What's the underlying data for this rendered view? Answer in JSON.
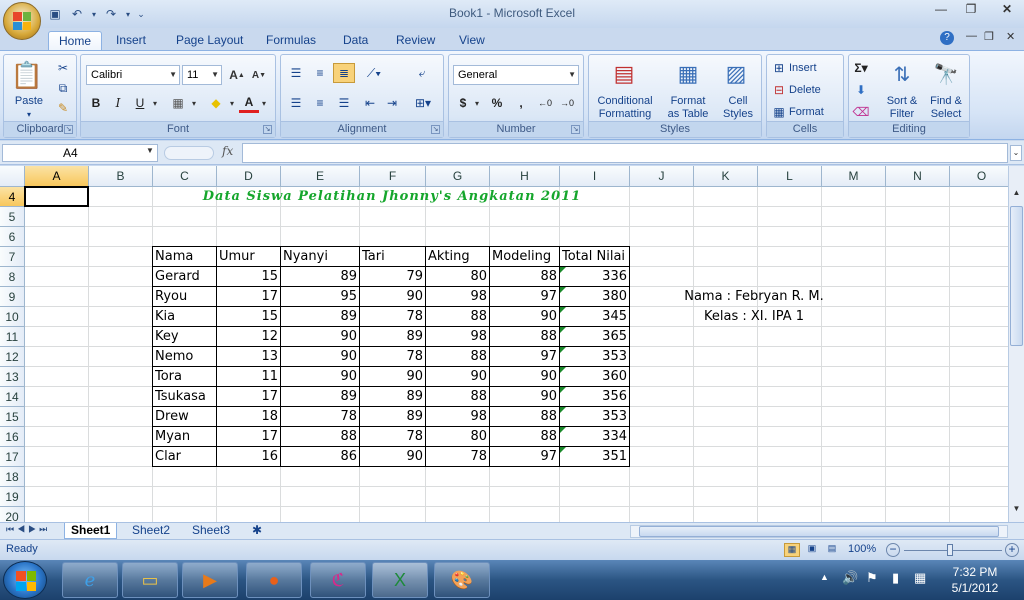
{
  "window": {
    "title": "Book1 - Microsoft Excel"
  },
  "ribbon_tabs": [
    "Home",
    "Insert",
    "Page Layout",
    "Formulas",
    "Data",
    "Review",
    "View"
  ],
  "ribbon": {
    "clipboard": {
      "label": "Clipboard",
      "paste": "Paste"
    },
    "font": {
      "label": "Font",
      "name": "Calibri",
      "size": "11",
      "bold": "B",
      "italic": "I",
      "underline": "U"
    },
    "alignment": {
      "label": "Alignment"
    },
    "number": {
      "label": "Number",
      "format": "General",
      "currency": "$",
      "percent": "%",
      "comma": ","
    },
    "styles": {
      "label": "Styles",
      "conditional": "Conditional\nFormatting",
      "format_table": "Format\nas Table",
      "cell_styles": "Cell\nStyles"
    },
    "cells": {
      "label": "Cells",
      "insert": "Insert",
      "delete": "Delete",
      "format": "Format"
    },
    "editing": {
      "label": "Editing",
      "sort": "Sort &\nFilter",
      "find": "Find &\nSelect"
    }
  },
  "formula_bar": {
    "name_box": "A4",
    "fx": "fx",
    "value": ""
  },
  "columns": [
    "A",
    "B",
    "C",
    "D",
    "E",
    "F",
    "G",
    "H",
    "I",
    "J",
    "K",
    "L",
    "M",
    "N",
    "O"
  ],
  "rows": [
    "4",
    "5",
    "6",
    "7",
    "8",
    "9",
    "10",
    "11",
    "12",
    "13",
    "14",
    "15",
    "16",
    "17",
    "18",
    "19",
    "20"
  ],
  "sheet": {
    "title": "Data Siswa Pelatihan  Jhonny's Angkatan 2011",
    "headers": [
      "Nama",
      "Umur",
      "Nyanyi",
      "Tari",
      "Akting",
      "Modeling",
      "Total Nilai"
    ],
    "data": [
      [
        "Gerard",
        "15",
        "89",
        "79",
        "80",
        "88",
        "336"
      ],
      [
        "Ryou",
        "17",
        "95",
        "90",
        "98",
        "97",
        "380"
      ],
      [
        "Kia",
        "15",
        "89",
        "78",
        "88",
        "90",
        "345"
      ],
      [
        "Key",
        "12",
        "90",
        "89",
        "98",
        "88",
        "365"
      ],
      [
        "Nemo",
        "13",
        "90",
        "78",
        "88",
        "97",
        "353"
      ],
      [
        "Tora",
        "11",
        "90",
        "90",
        "90",
        "90",
        "360"
      ],
      [
        "Tsukasa",
        "17",
        "89",
        "89",
        "88",
        "90",
        "356"
      ],
      [
        "Drew",
        "18",
        "78",
        "89",
        "98",
        "88",
        "353"
      ],
      [
        "Myan",
        "17",
        "88",
        "78",
        "80",
        "88",
        "334"
      ],
      [
        "Clar",
        "16",
        "86",
        "90",
        "78",
        "97",
        "351"
      ]
    ],
    "nama": "Nama : Febryan R. M.",
    "kelas": "Kelas : XI. IPA 1"
  },
  "sheet_tabs": [
    "Sheet1",
    "Sheet2",
    "Sheet3"
  ],
  "status": {
    "ready": "Ready",
    "zoom": "100%"
  },
  "clock": {
    "time": "7:32 PM",
    "date": "5/1/2012"
  }
}
